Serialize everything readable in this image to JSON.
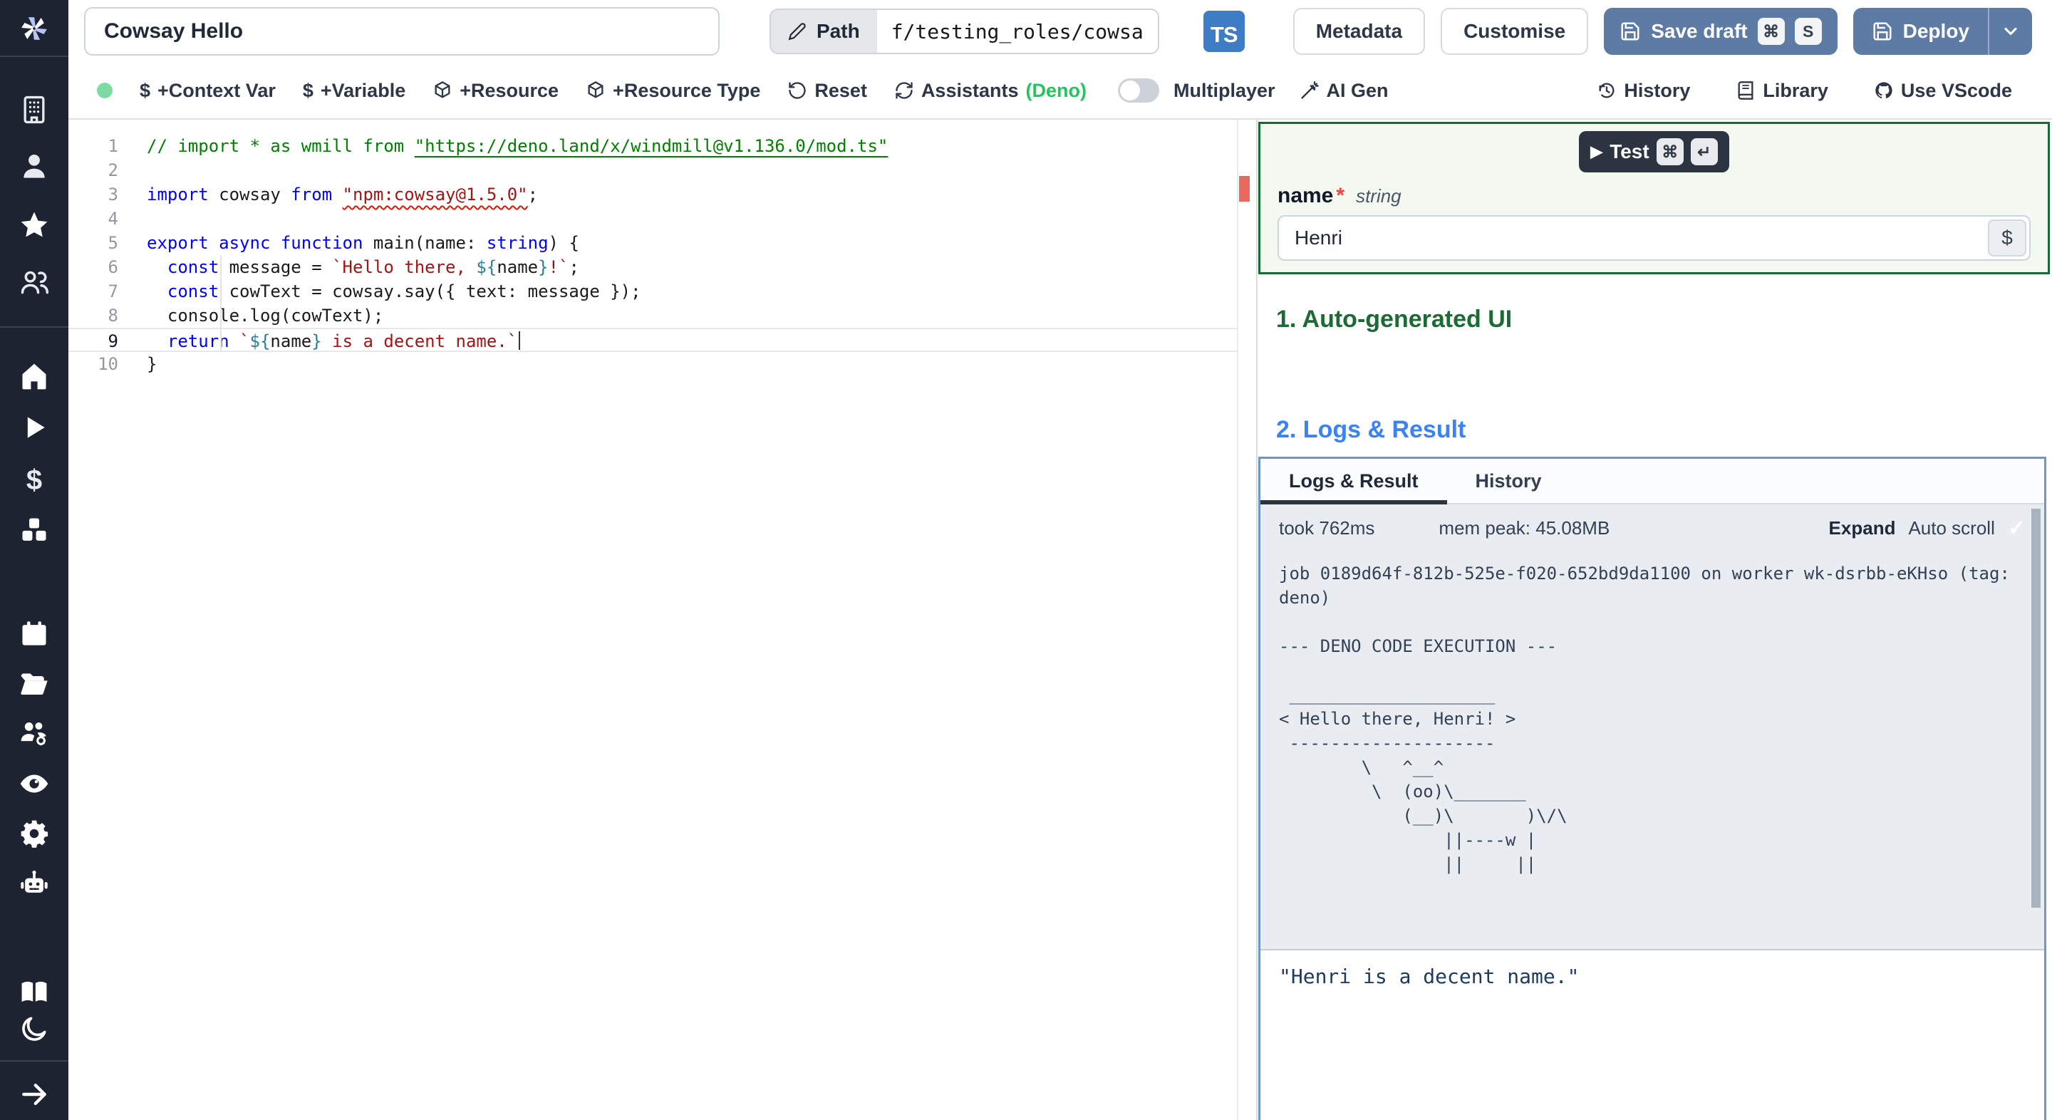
{
  "header": {
    "title_value": "Cowsay Hello",
    "path_label": "Path",
    "path_value": "f/testing_roles/cowsa",
    "lang_badge": "TS",
    "metadata_label": "Metadata",
    "customise_label": "Customise",
    "save_draft_label": "Save draft",
    "save_kbd_1": "⌘",
    "save_kbd_2": "S",
    "deploy_label": "Deploy"
  },
  "toolbar": {
    "items": [
      {
        "label": "+Context Var"
      },
      {
        "label": "+Variable"
      },
      {
        "label": "+Resource"
      },
      {
        "label": "+Resource Type"
      },
      {
        "label": "Reset"
      },
      {
        "label": "Assistants",
        "suffix": "(Deno)"
      }
    ],
    "multiplayer_label": "Multiplayer",
    "ai_gen_label": "AI Gen",
    "history_label": "History",
    "library_label": "Library",
    "vscode_label": "Use VScode"
  },
  "editor": {
    "current_line": 9,
    "lines": [
      {
        "n": 1,
        "seg": [
          {
            "t": "// import * as wmill from ",
            "c": "cm"
          },
          {
            "t": "\"https://deno.land/x/windmill@v1.136.0/mod.ts\"",
            "c": "cm lnk"
          }
        ]
      },
      {
        "n": 2,
        "seg": []
      },
      {
        "n": 3,
        "seg": [
          {
            "t": "import",
            "c": "kw"
          },
          {
            "t": " cowsay ",
            "c": "pl"
          },
          {
            "t": "from",
            "c": "kw"
          },
          {
            "t": " ",
            "c": "pl"
          },
          {
            "t": "\"npm:cowsay@1.5.0\"",
            "c": "str sq"
          },
          {
            "t": ";",
            "c": "pl"
          }
        ]
      },
      {
        "n": 4,
        "seg": []
      },
      {
        "n": 5,
        "seg": [
          {
            "t": "export",
            "c": "kw"
          },
          {
            "t": " ",
            "c": "pl"
          },
          {
            "t": "async",
            "c": "kw"
          },
          {
            "t": " ",
            "c": "pl"
          },
          {
            "t": "function",
            "c": "kw"
          },
          {
            "t": " main(name: ",
            "c": "pl"
          },
          {
            "t": "string",
            "c": "kw"
          },
          {
            "t": ") {",
            "c": "pl"
          }
        ]
      },
      {
        "n": 6,
        "seg": [
          {
            "t": "  ",
            "c": "pl"
          },
          {
            "t": "const",
            "c": "kw"
          },
          {
            "t": " message = ",
            "c": "pl"
          },
          {
            "t": "`Hello there, ",
            "c": "str"
          },
          {
            "t": "${",
            "c": "tpl"
          },
          {
            "t": "name",
            "c": "pl"
          },
          {
            "t": "}",
            "c": "tpl"
          },
          {
            "t": "!`",
            "c": "str"
          },
          {
            "t": ";",
            "c": "pl"
          }
        ]
      },
      {
        "n": 7,
        "seg": [
          {
            "t": "  ",
            "c": "pl"
          },
          {
            "t": "const",
            "c": "kw"
          },
          {
            "t": " cowText = cowsay.say({ text: message });",
            "c": "pl"
          }
        ]
      },
      {
        "n": 8,
        "seg": [
          {
            "t": "  console.log(cowText);",
            "c": "pl"
          }
        ]
      },
      {
        "n": 9,
        "seg": [
          {
            "t": "  ",
            "c": "pl"
          },
          {
            "t": "return",
            "c": "kw"
          },
          {
            "t": " ",
            "c": "pl"
          },
          {
            "t": "`",
            "c": "str"
          },
          {
            "t": "${",
            "c": "tpl"
          },
          {
            "t": "name",
            "c": "pl"
          },
          {
            "t": "}",
            "c": "tpl"
          },
          {
            "t": " is a decent name.`",
            "c": "str"
          }
        ]
      },
      {
        "n": 10,
        "seg": [
          {
            "t": "}",
            "c": "pl"
          }
        ]
      }
    ]
  },
  "panel": {
    "test_label": "Test",
    "test_kbd_1": "⌘",
    "test_kbd_2": "↵",
    "field_name": "name",
    "field_required": "*",
    "field_type": "string",
    "field_value": "Henri",
    "dollar_label": "$",
    "section_1": "1. Auto-generated UI",
    "section_2": "2. Logs & Result",
    "tabs": [
      "Logs & Result",
      "History"
    ],
    "status": {
      "took": "took 762ms",
      "mem": "mem peak: 45.08MB",
      "expand": "Expand",
      "autoscroll": "Auto scroll",
      "check": "✓"
    },
    "log_lines": [
      "job 0189d64f-812b-525e-f020-652bd9da1100 on worker wk-dsrbb-eKHso (tag: deno)",
      "",
      "--- DENO CODE EXECUTION ---",
      "",
      " ____________________",
      "< Hello there, Henri! >",
      " --------------------",
      "        \\   ^__^",
      "         \\  (oo)\\_______",
      "            (__)\\       )\\/\\",
      "                ||----w |",
      "                ||     ||"
    ],
    "result_value": "\"Henri is a decent name.\""
  },
  "colors": {
    "accent_blue_button": "#5e7ba6",
    "panel_green_border": "#176a33",
    "section1_green": "#1c6b34",
    "section2_blue": "#3b82f6",
    "logs_card_border": "#6e96c8",
    "ts_badge_blue": "#3e7cc6",
    "deno_green": "#22c55e",
    "error_red": "#e9695e"
  }
}
